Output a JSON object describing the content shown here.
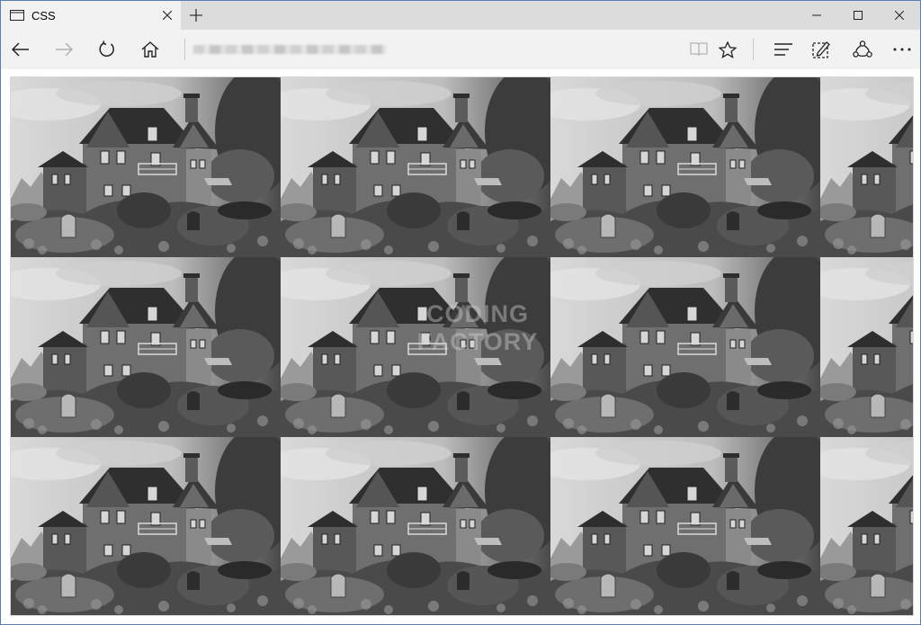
{
  "browser": {
    "tab_title": "CSS",
    "icons": {
      "tab": "page-icon",
      "close_tab": "close-icon",
      "new_tab": "plus-icon",
      "minimize": "minimize-icon",
      "maximize": "maximize-icon",
      "close_window": "close-icon",
      "back": "back-arrow-icon",
      "forward": "forward-arrow-icon",
      "refresh": "refresh-icon",
      "home": "home-icon",
      "reading_view": "book-icon",
      "favorite": "star-icon",
      "hub": "hub-icon",
      "web_note": "pen-note-icon",
      "share": "share-icon",
      "more": "more-icon"
    }
  },
  "page": {
    "watermark": "CODING FACTORY",
    "tile_subject": "grayscale haunted house photo"
  },
  "colors": {
    "frame_border": "#5a7fb5",
    "titlebar": "#dcdcdc",
    "toolbar": "#f2f2f2"
  }
}
